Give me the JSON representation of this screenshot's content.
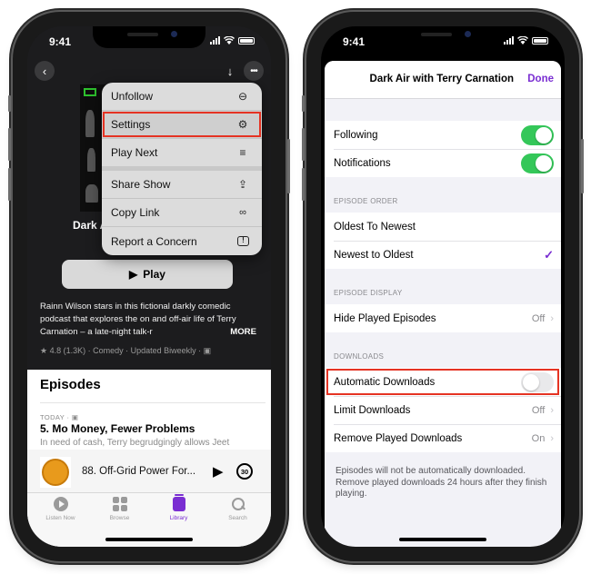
{
  "left_phone": {
    "status": {
      "time": "9:41"
    },
    "nav": {
      "back_icon": "chevron-left-icon",
      "download_icon": "download-arrow-icon",
      "more_icon": "ellipsis-icon"
    },
    "show_title_peek": "Dark A",
    "context_menu": {
      "items": [
        {
          "label": "Unfollow",
          "icon": "minus-circle-icon",
          "glyph": "⊖"
        },
        {
          "label": "Settings",
          "icon": "settings-gear-icon",
          "glyph": "⚙",
          "highlighted": true
        },
        {
          "label": "Play Next",
          "icon": "play-next-icon",
          "glyph": "≡"
        },
        {
          "label": "Share Show",
          "icon": "share-icon",
          "glyph": "⇪"
        },
        {
          "label": "Copy Link",
          "icon": "link-icon",
          "glyph": "🔗"
        },
        {
          "label": "Report a Concern",
          "icon": "report-bubble-icon",
          "glyph": "!"
        }
      ]
    },
    "play_button": {
      "icon": "▶",
      "label": "Play"
    },
    "description": {
      "text": "Rainn Wilson stars in this fictional darkly comedic podcast that explores the on and off-air life of Terry Carnation – a late-night talk-r",
      "more_label": "MORE"
    },
    "meta": "★ 4.8 (1.3K) · Comedy · Updated Biweekly · ▣",
    "episodes": {
      "heading": "Episodes",
      "items": [
        {
          "date": "TODAY · ▣",
          "title": "5. Mo Money, Fewer Problems",
          "description": "In need of cash, Terry begrudgingly allows Jeet"
        }
      ]
    },
    "mini_player": {
      "title": "88. Off-Grid Power For...",
      "play_icon": "▶",
      "skip_label": "30"
    },
    "tab_bar": {
      "tabs": [
        {
          "label": "Listen Now",
          "active": false
        },
        {
          "label": "Browse",
          "active": false
        },
        {
          "label": "Library",
          "active": true
        },
        {
          "label": "Search",
          "active": false
        }
      ]
    }
  },
  "right_phone": {
    "status": {
      "time": "9:41"
    },
    "sheet": {
      "title": "Dark Air with Terry Carnation",
      "done_label": "Done",
      "toggles": [
        {
          "label": "Following",
          "on": true
        },
        {
          "label": "Notifications",
          "on": true
        }
      ],
      "episode_order": {
        "section_label": "EPISODE ORDER",
        "options": [
          {
            "label": "Oldest To Newest",
            "selected": false
          },
          {
            "label": "Newest to Oldest",
            "selected": true
          }
        ],
        "check_glyph": "✓"
      },
      "episode_display": {
        "section_label": "EPISODE DISPLAY",
        "rows": [
          {
            "label": "Hide Played Episodes",
            "value": "Off"
          }
        ]
      },
      "downloads": {
        "section_label": "DOWNLOADS",
        "automatic_downloads": {
          "label": "Automatic Downloads",
          "on": false,
          "highlighted": true
        },
        "rows": [
          {
            "label": "Limit Downloads",
            "value": "Off"
          },
          {
            "label": "Remove Played Downloads",
            "value": "On"
          }
        ]
      },
      "footer_note": "Episodes will not be automatically downloaded. Remove played downloads 24 hours after they finish playing.",
      "chevron": "›"
    }
  },
  "colors": {
    "accent_purple": "#7a2ed2",
    "toggle_green": "#34c759",
    "highlight_red": "#e53323"
  }
}
